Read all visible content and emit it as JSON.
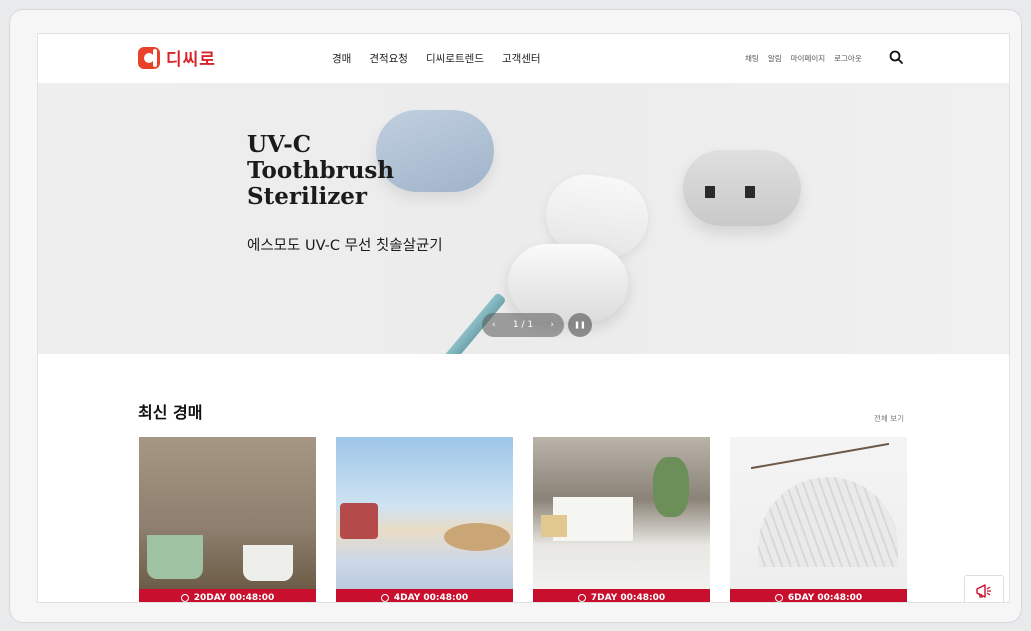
{
  "brand": {
    "logo_text": "디씨로",
    "accent": "#d8262c"
  },
  "nav": {
    "main": [
      "경매",
      "견적요청",
      "디씨로트렌드",
      "고객센터"
    ],
    "util": [
      "채팅",
      "알림",
      "마이페이지",
      "로그아웃"
    ]
  },
  "hero": {
    "title": "UV-C\nToothbrush\nSterilizer",
    "subtitle": "에스모도 UV-C 무선 칫솔살균기",
    "slide_counter": "1 / 1",
    "prev_icon": "‹",
    "next_icon": "›",
    "pause_icon": "❚❚"
  },
  "auctions": {
    "title": "최신 경매",
    "view_all": "전체 보기",
    "cards": [
      {
        "timer": "20DAY 00:48:00",
        "image": "mugs on wooden table"
      },
      {
        "timer": "4DAY 00:48:00",
        "image": "beach picnic with radio and hat"
      },
      {
        "timer": "7DAY 00:48:00",
        "image": "paper shopping bags"
      },
      {
        "timer": "6DAY 00:48:00",
        "image": "folding fan with branches"
      }
    ],
    "timer_color": "#c8102e"
  },
  "icons": {
    "search": "search-icon",
    "megaphone": "megaphone-icon"
  }
}
